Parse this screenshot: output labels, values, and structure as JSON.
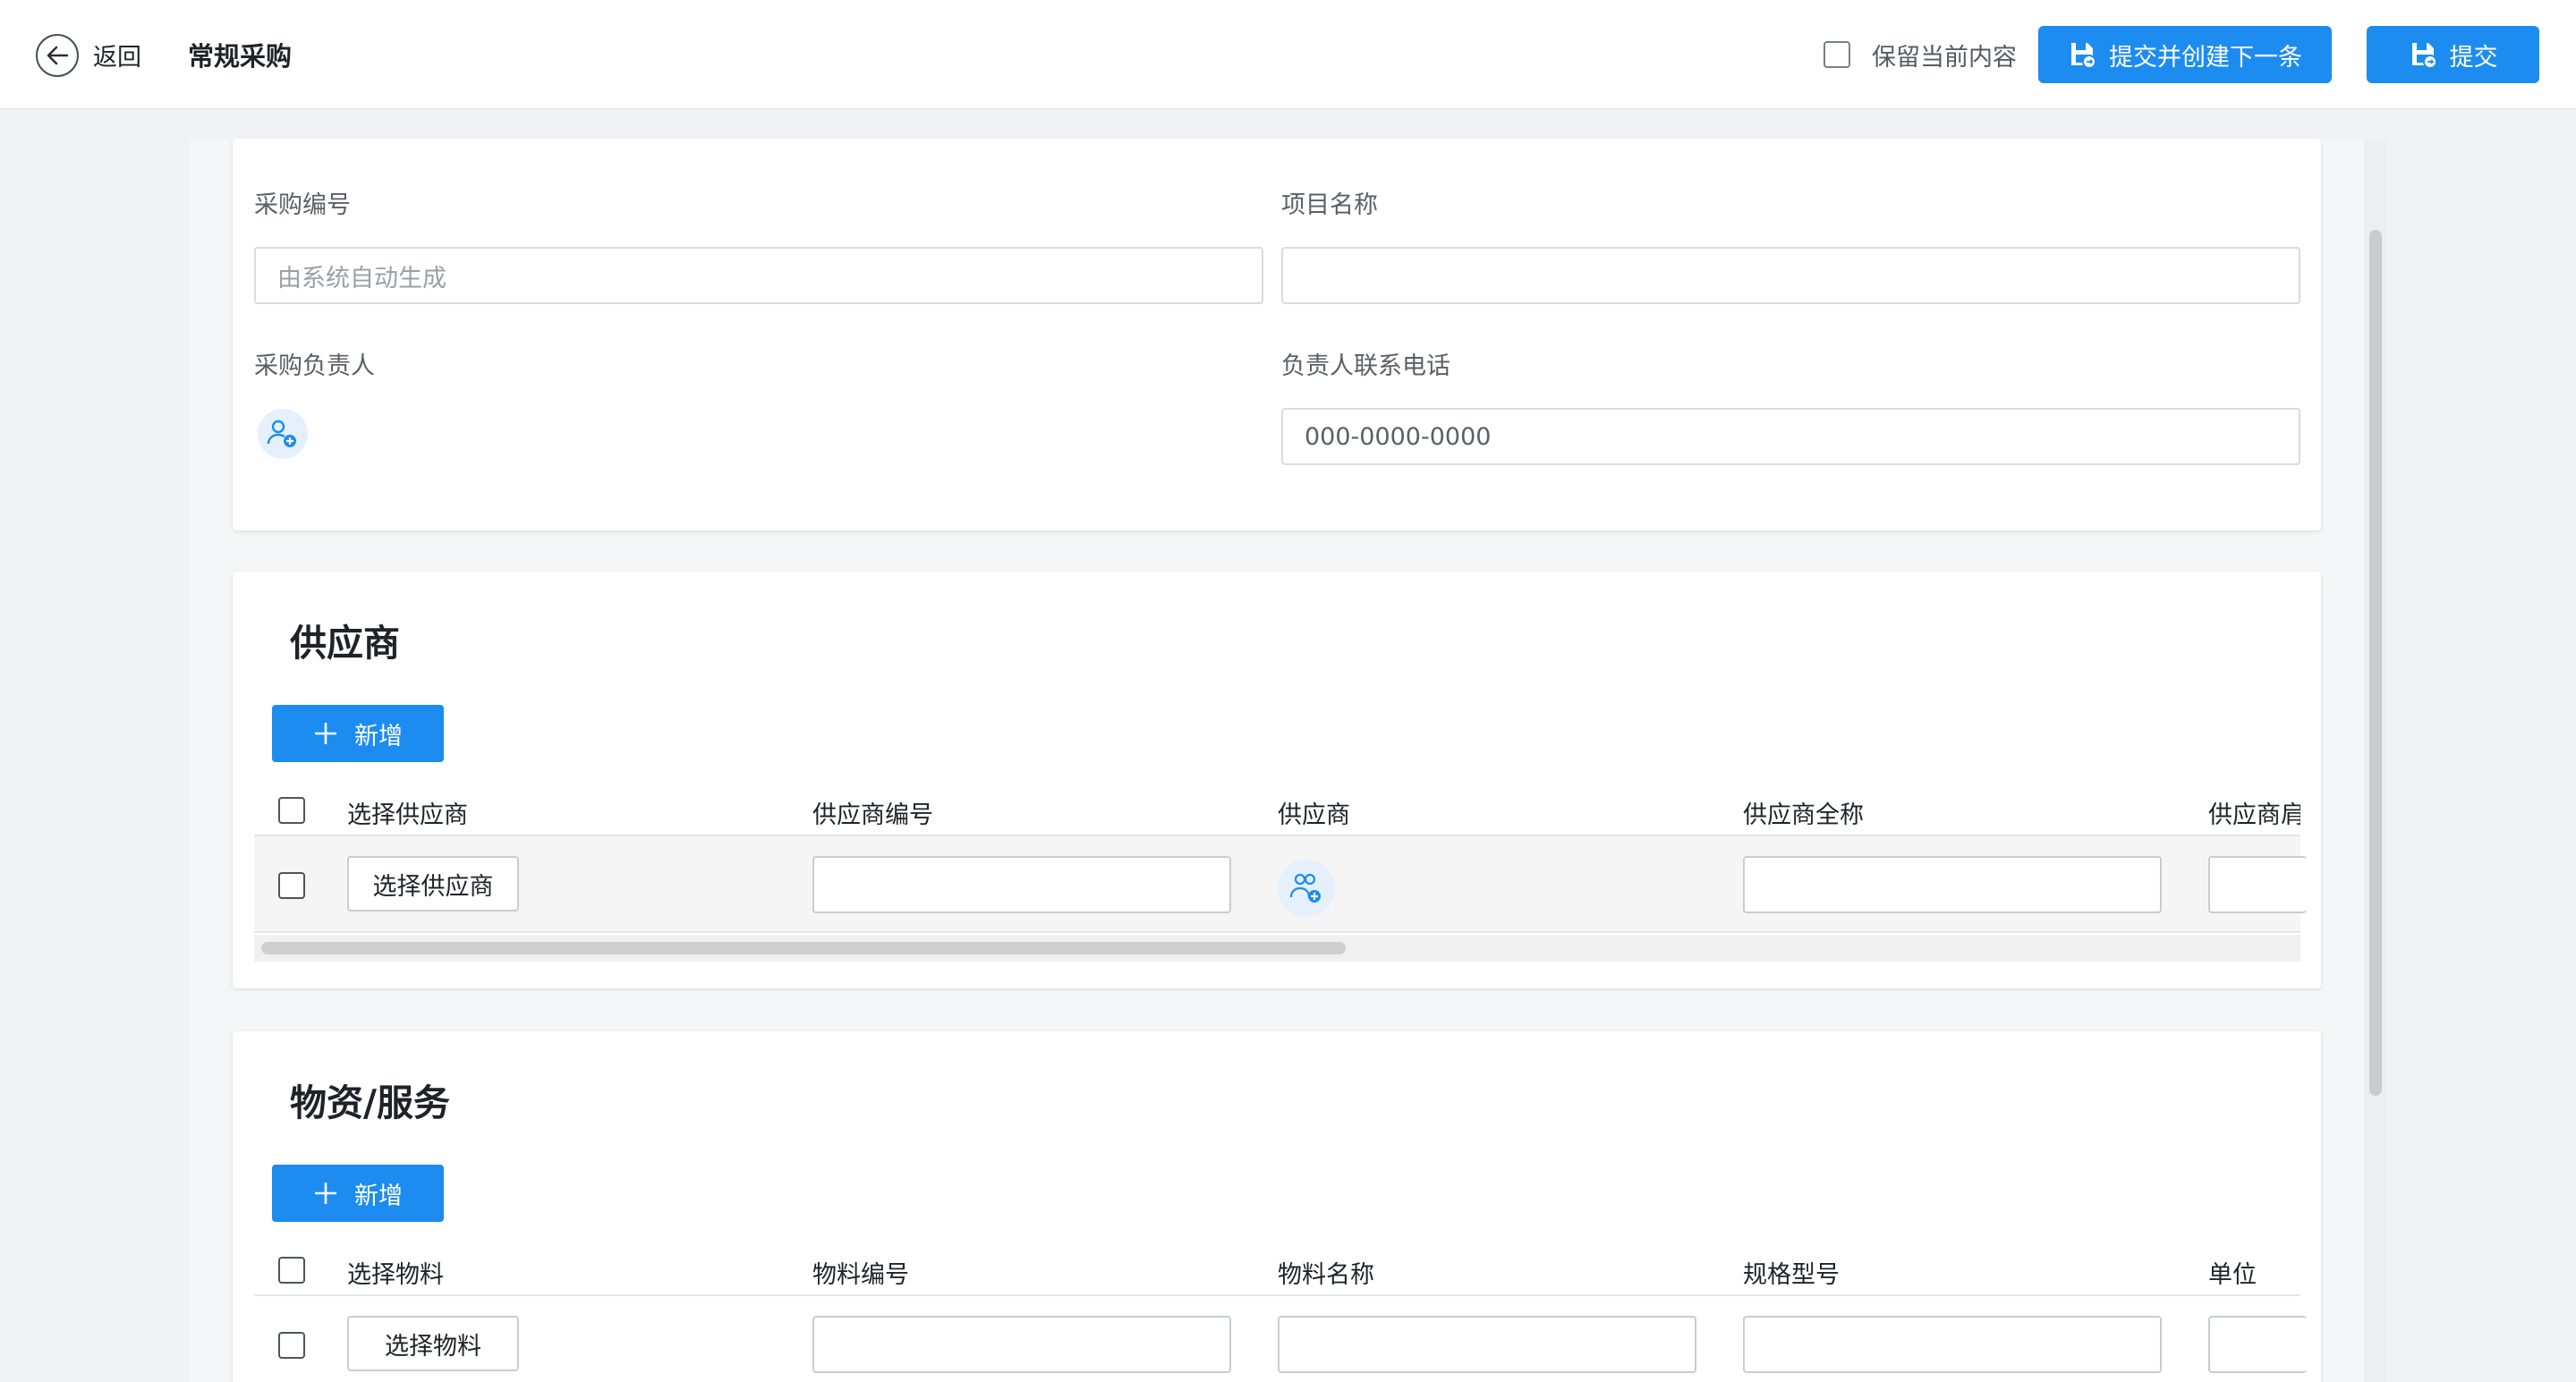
{
  "header": {
    "back_label": "返回",
    "title": "常规采购",
    "keep_content_label": "保留当前内容",
    "submit_next_label": "提交并创建下一条",
    "submit_label": "提交"
  },
  "basic": {
    "purchase_no_label": "采购编号",
    "purchase_no_placeholder": "由系统自动生成",
    "project_name_label": "项目名称",
    "owner_label": "采购负责人",
    "phone_label": "负责人联系电话",
    "phone_placeholder": "000-0000-0000"
  },
  "supplier": {
    "title": "供应商",
    "add_label": "新增",
    "columns": [
      "选择供应商",
      "供应商编号",
      "供应商",
      "供应商全称",
      "供应商肩"
    ],
    "row_select_label": "选择供应商"
  },
  "material": {
    "title": "物资/服务",
    "add_label": "新增",
    "columns": [
      "选择物料",
      "物料编号",
      "物料名称",
      "规格型号",
      "单位"
    ],
    "row_select_label": "选择物料"
  },
  "colors": {
    "primary": "#1d8cf0",
    "background": "#f0f2f5"
  },
  "icons": [
    "arrow-left-icon",
    "save-icon",
    "user-add-icon",
    "users-add-icon",
    "plus-icon"
  ]
}
